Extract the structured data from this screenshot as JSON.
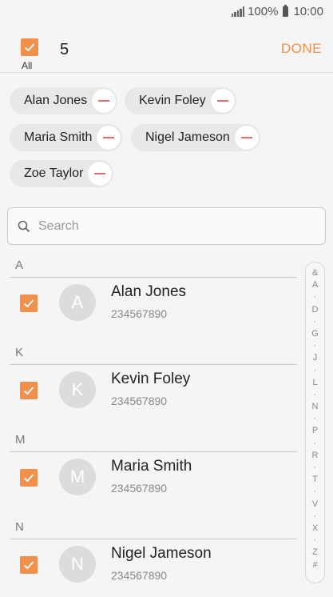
{
  "status": {
    "battery": "100%",
    "time": "10:00"
  },
  "header": {
    "all_label": "All",
    "selected_count": "5",
    "done_label": "DONE"
  },
  "chips": [
    {
      "name": "Alan Jones"
    },
    {
      "name": "Kevin Foley"
    },
    {
      "name": "Maria Smith"
    },
    {
      "name": "Nigel Jameson"
    },
    {
      "name": "Zoe Taylor"
    }
  ],
  "search": {
    "placeholder": "Search"
  },
  "sections": [
    {
      "letter": "A",
      "contact": {
        "initial": "A",
        "name": "Alan Jones",
        "phone": "234567890",
        "checked": true
      }
    },
    {
      "letter": "K",
      "contact": {
        "initial": "K",
        "name": "Kevin Foley",
        "phone": "234567890",
        "checked": true
      }
    },
    {
      "letter": "M",
      "contact": {
        "initial": "M",
        "name": "Maria Smith",
        "phone": "234567890",
        "checked": true
      }
    },
    {
      "letter": "N",
      "contact": {
        "initial": "N",
        "name": "Nigel Jameson",
        "phone": "234567890",
        "checked": true
      }
    }
  ],
  "index_letters": [
    "&",
    "A",
    "·",
    "D",
    "·",
    "G",
    "·",
    "J",
    "·",
    "L",
    "·",
    "N",
    "·",
    "P",
    "·",
    "R",
    "·",
    "T",
    "·",
    "V",
    "·",
    "X",
    "·",
    "Z",
    "#"
  ],
  "colors": {
    "accent": "#f1904a",
    "remove": "#e86b6b"
  }
}
